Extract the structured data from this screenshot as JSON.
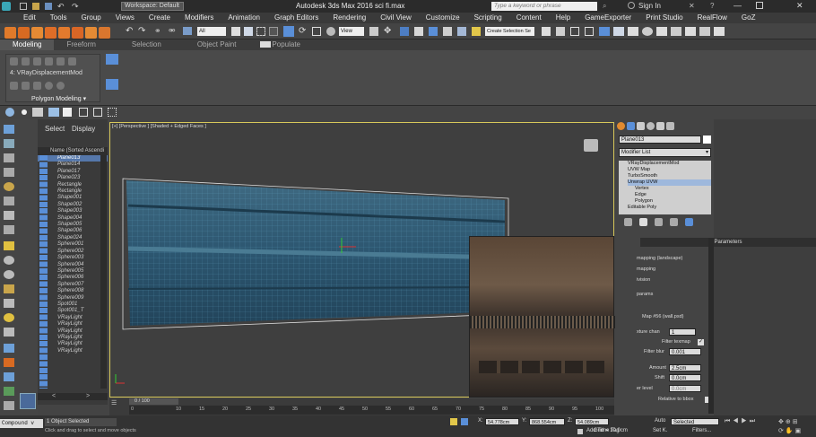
{
  "window": {
    "title": "Autodesk 3ds Max 2016    sci fi.max",
    "workspace": "Workspace: Default",
    "search_placeholder": "Type a keyword or phrase",
    "sign_in": "Sign In"
  },
  "menu": [
    "Edit",
    "Tools",
    "Group",
    "Views",
    "Create",
    "Modifiers",
    "Animation",
    "Graph Editors",
    "Rendering",
    "Civil View",
    "Customize",
    "Scripting",
    "Content",
    "Help",
    "GameExporter",
    "Print Studio",
    "RealFlow",
    "GoZ"
  ],
  "toolbar": {
    "selection_filter": "All",
    "view_dropdown": "View",
    "create_selection": "Create Selection Se"
  },
  "ribbon_tabs": [
    "Modeling",
    "Freeform",
    "Selection",
    "Object Paint",
    "Populate"
  ],
  "ribbon": {
    "modifier_label": "4: VRayDisplacementMod",
    "panel_label": "Polygon Modeling"
  },
  "scene_explorer": {
    "tabs": [
      "Select",
      "Display"
    ],
    "column": "Name (Sorted Ascendi",
    "objects": [
      "Plane013",
      "Plane014",
      "Plane017",
      "Plane023",
      "Rectangle",
      "Rectangle",
      "Shape001",
      "Shape002",
      "Shape003",
      "Shape004",
      "Shape005",
      "Shape006",
      "Shape024",
      "Sphere001",
      "Sphere002",
      "Sphere003",
      "Sphere004",
      "Sphere005",
      "Sphere006",
      "Sphere007",
      "Sphere008",
      "Sphere009",
      "Spot001",
      "Spot001_T",
      "VRayLight",
      "VRayLight",
      "VRayLight",
      "VRayLight",
      "VRayLight",
      "VRayLight"
    ]
  },
  "viewport": {
    "label": "[+] [Perspective ] [Shaded + Edged Faces ]"
  },
  "command_panel": {
    "object_name": "Plane013",
    "modifier_list": "Modifier List",
    "stack": [
      "VRayDisplacementMod",
      "UVW Map",
      "TurboSmooth",
      "Unwrap UVW",
      "Vertex",
      "Edge",
      "Polygon",
      "Editable Poly"
    ],
    "parameters_title": "Parameters",
    "rollout": [
      "mapping (landscape)",
      "mapping",
      "ivision",
      "params",
      "Map #56 (wall.psd)"
    ],
    "texture_chan_label": "xture chan",
    "texture_chan_value": "1",
    "filter_texmap": "Filter texmap",
    "filter_blur_label": "Filter blur",
    "filter_blur_value": "0.001",
    "amount_label": "Amount",
    "amount_value": "2.5cm",
    "shift_label": "Shift",
    "shift_value": "0.0cm",
    "water_level_label": "er level",
    "water_level_value": "0.0cm",
    "relative_bbox": "Relative to bbox"
  },
  "timeline": {
    "frame": "0 / 100",
    "ticks": [
      "0",
      "10",
      "15",
      "20",
      "25",
      "30",
      "35",
      "40",
      "45",
      "50",
      "55",
      "60",
      "65",
      "70",
      "75",
      "80",
      "85",
      "90",
      "95",
      "100"
    ]
  },
  "status": {
    "selected": "1 Object Selected",
    "hint": "Click and drag to select and move objects",
    "x_label": "X:",
    "x": "54.778cm",
    "y_label": "Y:",
    "y": "868.554cm",
    "z_label": "Z:",
    "z": "54.089cm",
    "grid": "Grid = 10.0cm",
    "add_time_tag": "Add Time Tag",
    "auto": "Auto",
    "set_k": "Set K.",
    "selected_dd": "Selected",
    "filters": "Filters...",
    "maxscript": "Compound  v"
  },
  "colors": {
    "accent": "#d8c85a",
    "selection": "#5577aa",
    "viewport_bg": "#3f3f3f"
  }
}
